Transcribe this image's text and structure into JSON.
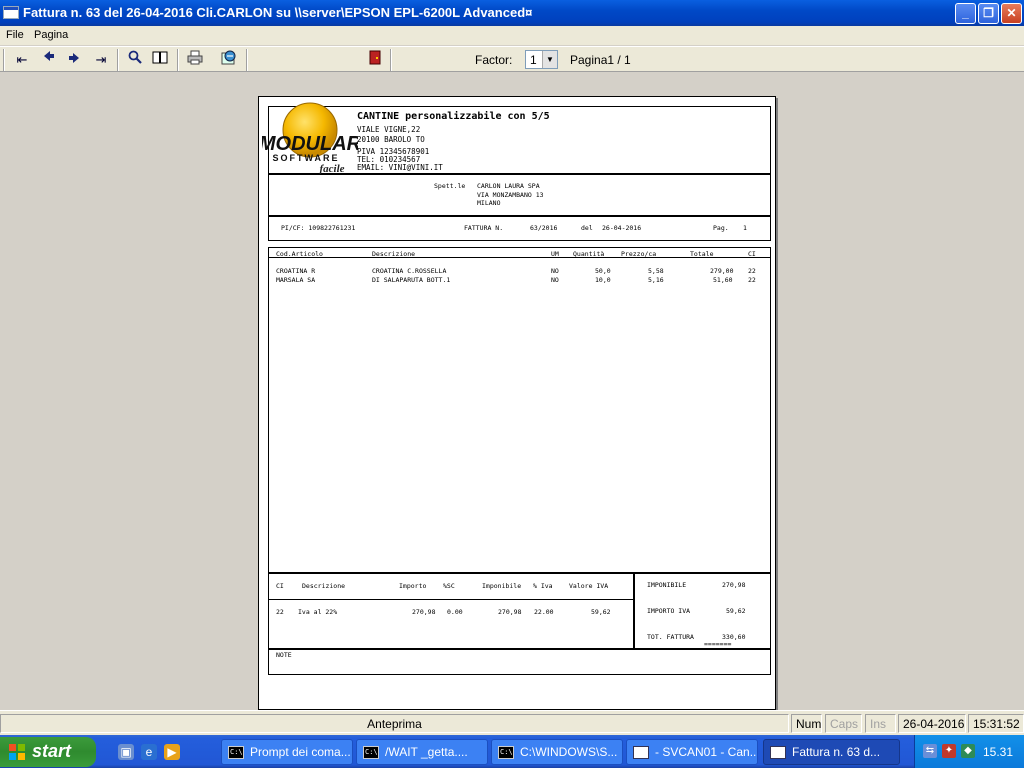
{
  "window": {
    "title": "Fattura n.  63 del 26-04-2016 Cli.CARLON su \\\\server\\EPSON EPL-6200L Advanced¤",
    "buttons": {
      "minimize": "_",
      "maximize": "❐",
      "close": "✕"
    }
  },
  "menu": {
    "file": "File",
    "page": "Pagina"
  },
  "toolbar": {
    "icons": {
      "first": "⇤",
      "prev": "◆",
      "next": "◆",
      "last": "⇥",
      "zoom": "🔍",
      "book": "▯▯",
      "print": "▤",
      "export": "↻",
      "exit": "▮"
    },
    "factor_label": "Factor:",
    "factor_value": "1",
    "page_label": "Pagina1 / 1"
  },
  "invoice": {
    "company": {
      "name": "CANTINE  personalizzabile con 5/5",
      "address": "VIALE VIGNE,22",
      "city": "20100 BAROLO TO",
      "piva": "PIVA 12345678901",
      "tel": "TEL: 010234567",
      "email": "EMAIL: VINI@VINI.IT"
    },
    "logo": {
      "line1": "MODULAR",
      "line2": "SOFTWARE",
      "line3": "facile"
    },
    "customer": {
      "label": "Spett.le",
      "name": "CARLON LAURA SPA",
      "street": "VIA MONZAMBANO 13",
      "city": "MILANO"
    },
    "info": {
      "vat": "PI/CF: 109822761231",
      "doc_label": "FATTURA   N.",
      "number": "63/2016",
      "date_label": "del",
      "date": "26-04-2016",
      "page_label": "Pag.",
      "page": "1"
    },
    "columns": [
      "Cod.Articolo",
      "Descrizione",
      "UM",
      "Quantità",
      "Prezzo/ca",
      "Totale",
      "CI"
    ],
    "rows": [
      [
        "CROATINA R",
        "CROATINA C.ROSSELLA",
        "NO",
        "50,0",
        "5,58",
        "279,00",
        "22"
      ],
      [
        "MARSALA SA",
        "DI SALAPARUTA BOTT.1",
        "NO",
        "10,0",
        "5,16",
        "51,60",
        "22"
      ]
    ],
    "vat_summary": {
      "headers": [
        "CI",
        "Descrizione",
        "Importo",
        "%SC",
        "Imponibile",
        "% Iva",
        "Valore IVA"
      ],
      "row": [
        "22",
        "Iva al 22%",
        "270,98",
        "0.00",
        "270,98",
        "22.00",
        "59,62"
      ]
    },
    "totals": {
      "imponibile_label": "IMPONIBILE",
      "imponibile": "270,98",
      "iva_label": "IMPORTO IVA",
      "iva": "59,62",
      "total_label": "TOT. FATTURA",
      "total": "330,60",
      "underline": "=======",
      "notes_label": "NOTE"
    }
  },
  "statusbar": {
    "preview": "Anteprima",
    "num": "Num",
    "caps": "Caps",
    "ins": "Ins",
    "date": "26-04-2016",
    "time": "15:31:52"
  },
  "taskbar": {
    "start": "start",
    "tasks": [
      {
        "label": "Prompt dei coma...",
        "icon": "C:\\"
      },
      {
        "label": "/WAIT _getta....",
        "icon": "C:\\"
      },
      {
        "label": "C:\\WINDOWS\\S...",
        "icon": "C:\\"
      },
      {
        "label": "- SVCAN01 - Can...",
        "icon": ""
      },
      {
        "label": "Fattura n.  63 d...",
        "icon": ""
      }
    ],
    "clock": "15.31"
  },
  "colors": {
    "title_bar": "#0049c7",
    "taskbar": "#245edc",
    "start_button": "#3c9b3c",
    "preview_bg": "#d4d0c8"
  }
}
